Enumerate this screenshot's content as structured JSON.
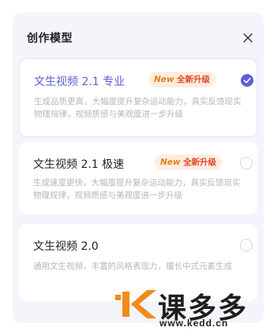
{
  "panel": {
    "title": "创作模型",
    "close_icon": "close-icon"
  },
  "models": [
    {
      "title": "文生视频 2.1 专业",
      "badge_new": "New",
      "badge_text": "全新升级",
      "description": "生成品质更高，大幅度提升复杂运动能力，真实反馈现实物理规律，视频质感与美观度进一步升级",
      "selected": true
    },
    {
      "title": "文生视频 2.1 极速",
      "badge_new": "New",
      "badge_text": "全新升级",
      "description": "生成速度更快，大幅度提升复杂运动能力，真实反馈现实物理规律，视频质感与美观度进一步升级",
      "selected": false
    },
    {
      "title": "文生视频 2.0",
      "description": "通用文生视频，丰富的风格表现力，擅长中式元素生成",
      "selected": false
    }
  ],
  "colors": {
    "accent": "#5a5fd6",
    "badge_bg": "#fdeee1",
    "badge_new": "#e67e22",
    "badge_text": "#e2462b",
    "description": "#b4b6c2",
    "panel_bg": "#f4f5fb"
  },
  "watermark": {
    "logo_text": "课多多",
    "url": "www.kedd.cn"
  }
}
